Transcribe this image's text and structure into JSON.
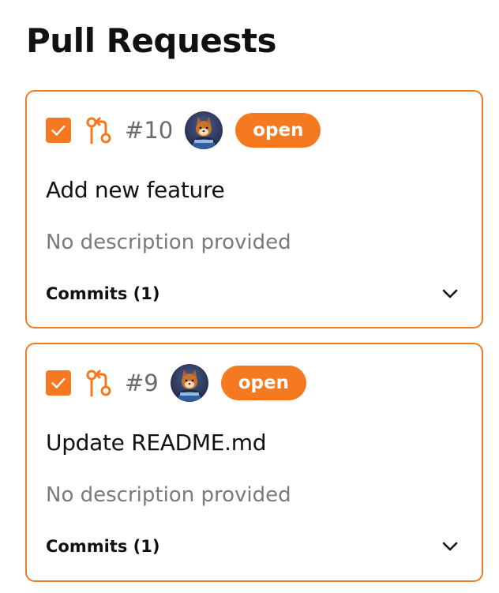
{
  "page": {
    "title": "Pull Requests"
  },
  "colors": {
    "accent": "#f47920",
    "border": "#f07a24",
    "muted_text": "#7a7a7a"
  },
  "pull_requests": [
    {
      "checked": true,
      "icon": "git-pull-request-icon",
      "number": "#10",
      "status": "open",
      "title": "Add new feature",
      "description": "No description provided",
      "commits_label": "Commits (1)"
    },
    {
      "checked": true,
      "icon": "git-pull-request-icon",
      "number": "#9",
      "status": "open",
      "title": "Update README.md",
      "description": "No description provided",
      "commits_label": "Commits (1)"
    }
  ]
}
